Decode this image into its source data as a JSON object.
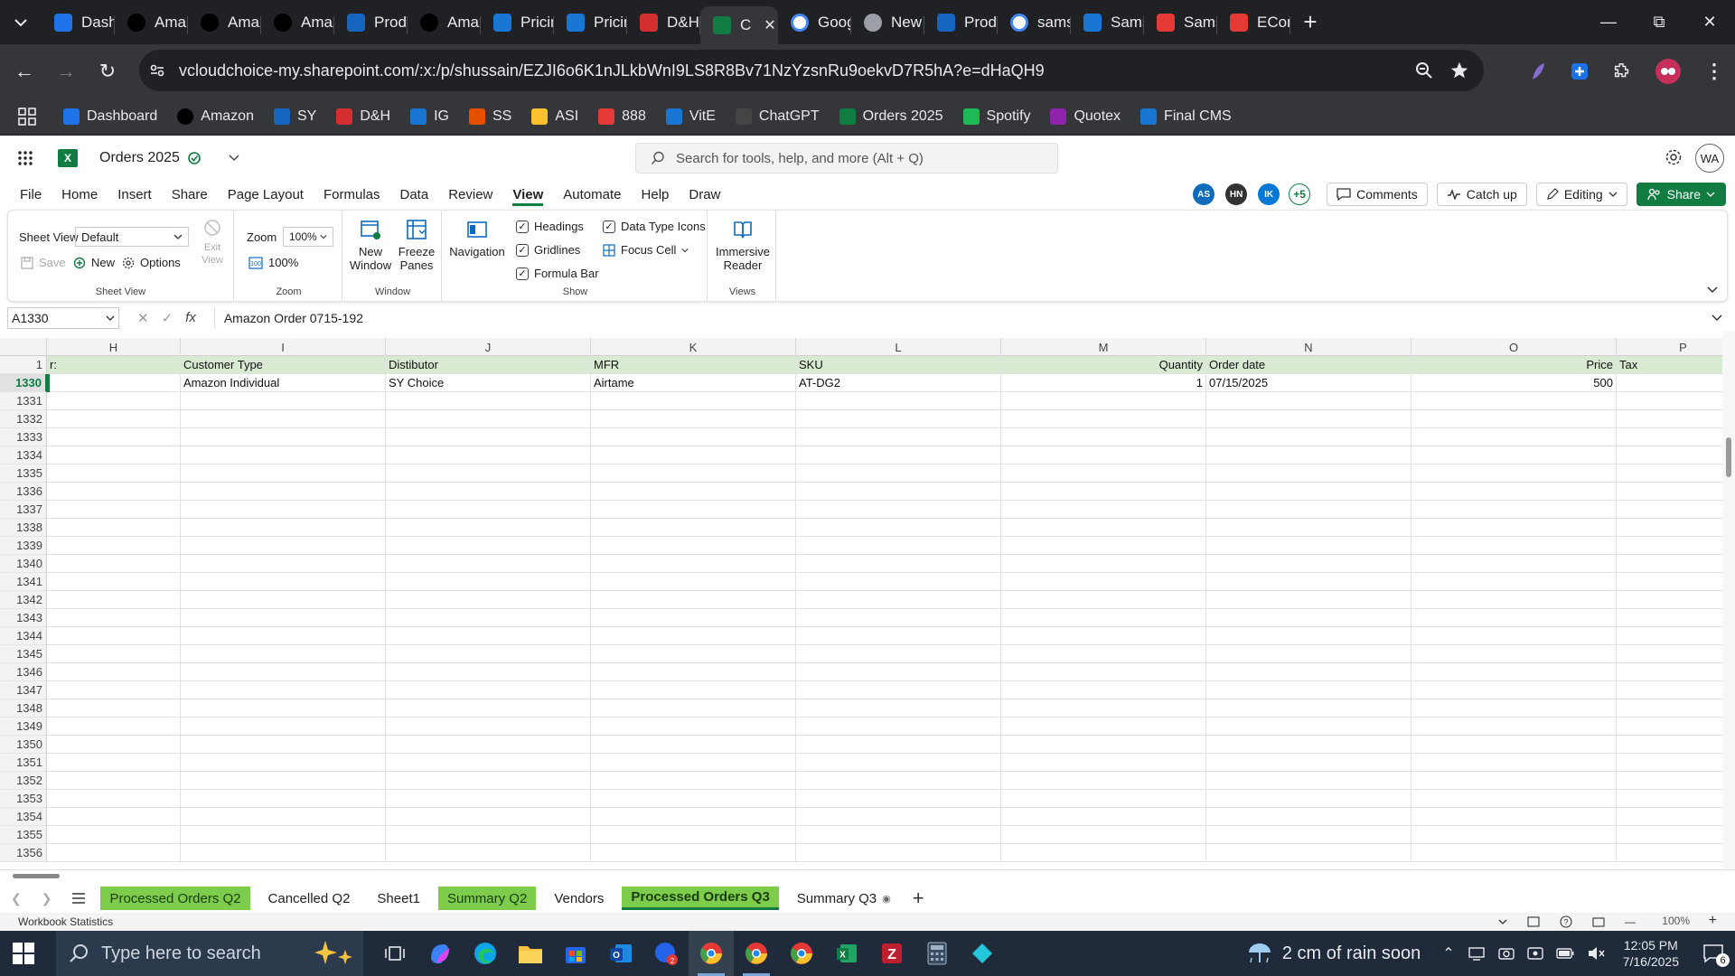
{
  "browser": {
    "tabs": [
      {
        "label": "Dashb",
        "icon": "dashboard-icon",
        "color": "#1e73e8"
      },
      {
        "label": "Amaz",
        "icon": "amazon-icon",
        "color": "#000000"
      },
      {
        "label": "Amaz",
        "icon": "amazon-icon",
        "color": "#000000"
      },
      {
        "label": "Amaz",
        "icon": "amazon-icon",
        "color": "#000000"
      },
      {
        "label": "Produ",
        "icon": "ec-icon",
        "color": "#1565c0"
      },
      {
        "label": "Amaz",
        "icon": "amazon-icon",
        "color": "#000000"
      },
      {
        "label": "Pricin",
        "icon": "s-icon",
        "color": "#1976d2"
      },
      {
        "label": "Pricin",
        "icon": "s-icon",
        "color": "#1976d2"
      },
      {
        "label": "D&H",
        "icon": "dh-icon",
        "color": "#d32f2f"
      },
      {
        "label": "C",
        "icon": "excel-icon",
        "color": "#107c41",
        "active": true
      },
      {
        "label": "Goog",
        "icon": "google-icon",
        "color": "#ffffff"
      },
      {
        "label": "New",
        "icon": "chrome-icon",
        "color": "#9aa0a6"
      },
      {
        "label": "Produ",
        "icon": "plus-icon",
        "color": "#1565c0"
      },
      {
        "label": "sams",
        "icon": "google-icon",
        "color": "#ffffff"
      },
      {
        "label": "Sams",
        "icon": "s-icon",
        "color": "#1976d2"
      },
      {
        "label": "Sams",
        "icon": "red-g-icon",
        "color": "#e53935"
      },
      {
        "label": "ECon",
        "icon": "ss-icon",
        "color": "#e53935"
      }
    ],
    "url": "vcloudchoice-my.sharepoint.com/:x:/p/shussain/EZJI6o6K1nJLkbWnI9LS8R8Bv71NzYzsnRu9oekvD7R5hA?e=dHaQH9",
    "bookmarks": [
      {
        "label": "Dashboard",
        "icon": "dashboard-icon",
        "color": "#1e73e8"
      },
      {
        "label": "Amazon",
        "icon": "amazon-icon",
        "color": "#000000"
      },
      {
        "label": "SY",
        "icon": "ec-icon",
        "color": "#1565c0"
      },
      {
        "label": "D&H",
        "icon": "dh-icon",
        "color": "#d32f2f"
      },
      {
        "label": "IG",
        "icon": "ig-icon",
        "color": "#1976d2"
      },
      {
        "label": "SS",
        "icon": "ss-icon",
        "color": "#e65100"
      },
      {
        "label": "ASI",
        "icon": "asi-icon",
        "color": "#fbc02d"
      },
      {
        "label": "888",
        "icon": "888-icon",
        "color": "#e53935"
      },
      {
        "label": "VitE",
        "icon": "s-icon",
        "color": "#1976d2"
      },
      {
        "label": "ChatGPT",
        "icon": "chatgpt-icon",
        "color": "#444444"
      },
      {
        "label": "Orders 2025",
        "icon": "excel-icon",
        "color": "#107c41"
      },
      {
        "label": "Spotify",
        "icon": "spotify-icon",
        "color": "#1db954"
      },
      {
        "label": "Quotex",
        "icon": "quotex-icon",
        "color": "#8e24aa"
      },
      {
        "label": "Final CMS",
        "icon": "s-icon",
        "color": "#1976d2"
      }
    ]
  },
  "excel": {
    "doc_name": "Orders 2025",
    "search_placeholder": "Search for tools, help, and more (Alt + Q)",
    "user_initials": "WA",
    "menus": [
      "File",
      "Home",
      "Insert",
      "Share",
      "Page Layout",
      "Formulas",
      "Data",
      "Review",
      "View",
      "Automate",
      "Help",
      "Draw"
    ],
    "active_menu": "View",
    "collaborators": [
      {
        "initials": "AS",
        "color": "#0f6cbd"
      },
      {
        "initials": "HN",
        "color": "#333333"
      },
      {
        "initials": "IK",
        "color": "#0078d4"
      }
    ],
    "more_collaborators": "+5",
    "comments_label": "Comments",
    "catchup_label": "Catch up",
    "editing_label": "Editing",
    "share_label": "Share",
    "ribbon": {
      "sheet_view_label": "Sheet View",
      "sheet_view_value": "Default",
      "save_label": "Save",
      "new_label": "New",
      "options_label": "Options",
      "exit_view_label": "Exit View",
      "group_sheet_view": "Sheet View",
      "zoom_label": "Zoom",
      "zoom_value": "100%",
      "zoom100_label": "100%",
      "group_zoom": "Zoom",
      "new_window_label": "New Window",
      "freeze_panes_label": "Freeze Panes",
      "group_window": "Window",
      "navigation_label": "Navigation",
      "headings_label": "Headings",
      "gridlines_label": "Gridlines",
      "formula_bar_label": "Formula Bar",
      "data_type_icons_label": "Data Type Icons",
      "focus_cell_label": "Focus Cell",
      "group_show": "Show",
      "immersive_reader_label": "Immersive Reader",
      "group_views": "Views"
    },
    "name_box": "A1330",
    "formula": "Amazon Order 0715-192",
    "columns": [
      "H",
      "I",
      "J",
      "K",
      "L",
      "M",
      "N",
      "O",
      "P"
    ],
    "header_row_number": "1",
    "header_row": [
      "r:",
      "Customer Type",
      "Distibutor",
      "MFR",
      "SKU",
      "Quantity",
      "Order date",
      "Price",
      "Tax"
    ],
    "data_row": {
      "number": "1330",
      "cells": [
        "",
        "Amazon Individual",
        "SY Choice",
        "Airtame",
        "AT-DG2",
        "1",
        "07/15/2025",
        "500",
        ""
      ]
    },
    "empty_rows": [
      "1331",
      "1332",
      "1333",
      "1334",
      "1335",
      "1336",
      "1337",
      "1338",
      "1339",
      "1340",
      "1341",
      "1342",
      "1343",
      "1344",
      "1345",
      "1346",
      "1347",
      "1348",
      "1349",
      "1350",
      "1351",
      "1352",
      "1353",
      "1354",
      "1355",
      "1356"
    ],
    "sheet_tabs": [
      {
        "label": "Processed Orders Q2",
        "green": true
      },
      {
        "label": "Cancelled Q2",
        "green": false
      },
      {
        "label": "Sheet1",
        "green": false
      },
      {
        "label": "Summary Q2",
        "green": true
      },
      {
        "label": "Vendors",
        "green": false
      },
      {
        "label": "Processed Orders Q3",
        "green": true,
        "active": true
      },
      {
        "label": "Summary Q3",
        "green": false,
        "hidden_icon": true
      }
    ],
    "status_left": "Workbook Statistics",
    "status_zoom": "100%"
  },
  "taskbar": {
    "search_placeholder": "Type here to search",
    "weather": "2 cm of rain soon",
    "time": "12:05 PM",
    "date": "7/16/2025",
    "notifications": "6"
  }
}
